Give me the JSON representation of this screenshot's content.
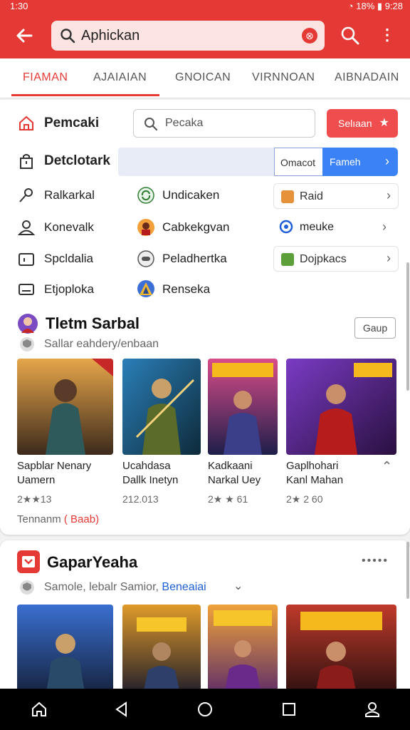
{
  "status": {
    "time": "1:30",
    "battery": "18%",
    "clock": "9:28"
  },
  "appbar": {
    "search_text": "Aphickan"
  },
  "tabs": [
    "FIAMAN",
    "AJAIAIAN",
    "GNOICAN",
    "VIRNNOAN",
    "AIBNADAIN"
  ],
  "filters": {
    "row1_label": "Pemcaki",
    "search_placeholder": "Pecaka",
    "select_button": "Selıaan",
    "row2_label": "Detclotark",
    "slot_value": "Omacot",
    "slot_button": "Fameh"
  },
  "options": [
    {
      "left": "Ralkarkal",
      "mid": "Undicaken",
      "right": "Raid"
    },
    {
      "left": "Konevalk",
      "mid": "Cabkekgvan",
      "right": "meuke"
    },
    {
      "left": "Spcldalia",
      "mid": "Peladhertka",
      "right": "Dojpkacs"
    },
    {
      "left": "Etjoploka",
      "mid": "Renseka",
      "right": ""
    }
  ],
  "section1": {
    "title": "Tletm Sarbal",
    "subtitle": "Sallar eahdery/enbaan",
    "button": "Gaup",
    "games": [
      {
        "line1": "Sapblar Nenary",
        "line2": "Uamern",
        "rating": "2★★13"
      },
      {
        "line1": "Ucahdasa",
        "line2": "Dallk Inetyn",
        "rating": "212.013"
      },
      {
        "line1": "Kadkaani",
        "line2": "Narkal Uey",
        "rating": "2★ ★ 61"
      },
      {
        "line1": "Gaplhohari",
        "line2": "Kanl Mahan",
        "rating": "2★ 2 60"
      }
    ],
    "footer_text": "Tennanm",
    "footer_link": "( Baab)"
  },
  "section2": {
    "title": "GaparYeaha",
    "subtitle": "Samole, lebalr Samior,",
    "subtitle_link": "Beneaiai"
  },
  "colors": {
    "accent": "#e53935",
    "blue": "#3b82f6"
  }
}
